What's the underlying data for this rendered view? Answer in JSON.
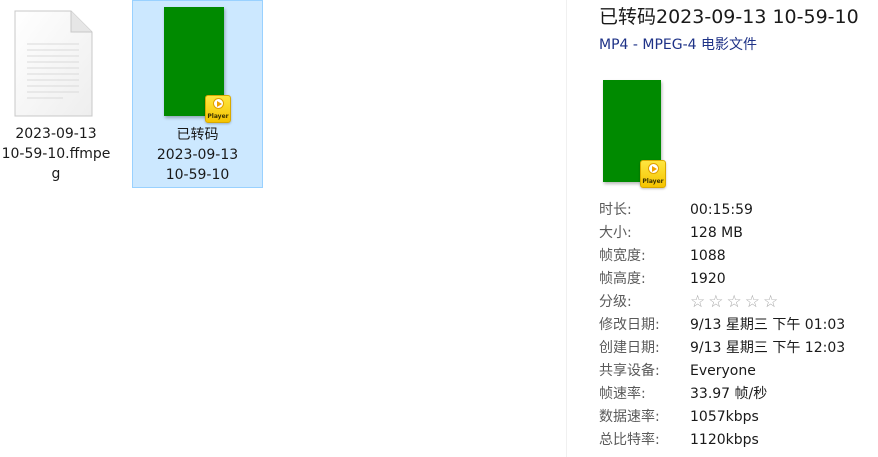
{
  "files": [
    {
      "name_lines": [
        "2023-09-13",
        "10-59-10.ffmpe",
        "g"
      ],
      "icon": "document-icon",
      "selected": false
    },
    {
      "name_lines": [
        "已转码",
        "2023-09-13",
        "10-59-10"
      ],
      "icon": "video-thumbnail",
      "badge": "Player",
      "selected": true
    }
  ],
  "details": {
    "title": "已转码2023-09-13 10-59-10",
    "type": "MP4 - MPEG-4 电影文件",
    "badge": "Player",
    "properties": [
      {
        "label": "时长:",
        "value": "00:15:59"
      },
      {
        "label": "大小:",
        "value": "128 MB"
      },
      {
        "label": "帧宽度:",
        "value": "1088"
      },
      {
        "label": "帧高度:",
        "value": "1920"
      },
      {
        "label": "分级:",
        "value": ""
      },
      {
        "label": "修改日期:",
        "value": "9/13 星期三 下午 01:03"
      },
      {
        "label": "创建日期:",
        "value": "9/13 星期三 下午 12:03"
      },
      {
        "label": "共享设备:",
        "value": "Everyone"
      },
      {
        "label": "帧速率:",
        "value": "33.97 帧/秒"
      },
      {
        "label": "数据速率:",
        "value": "1057kbps"
      },
      {
        "label": "总比特率:",
        "value": "1120kbps"
      }
    ],
    "rating": {
      "stars": 5,
      "filled": 0,
      "glyph": "☆"
    }
  },
  "colors": {
    "selection_bg": "#cce8ff",
    "selection_border": "#99d1ff",
    "thumbnail_green": "#008a00",
    "badge_yellow": "#f5c400",
    "type_text_blue": "#1e3287"
  }
}
